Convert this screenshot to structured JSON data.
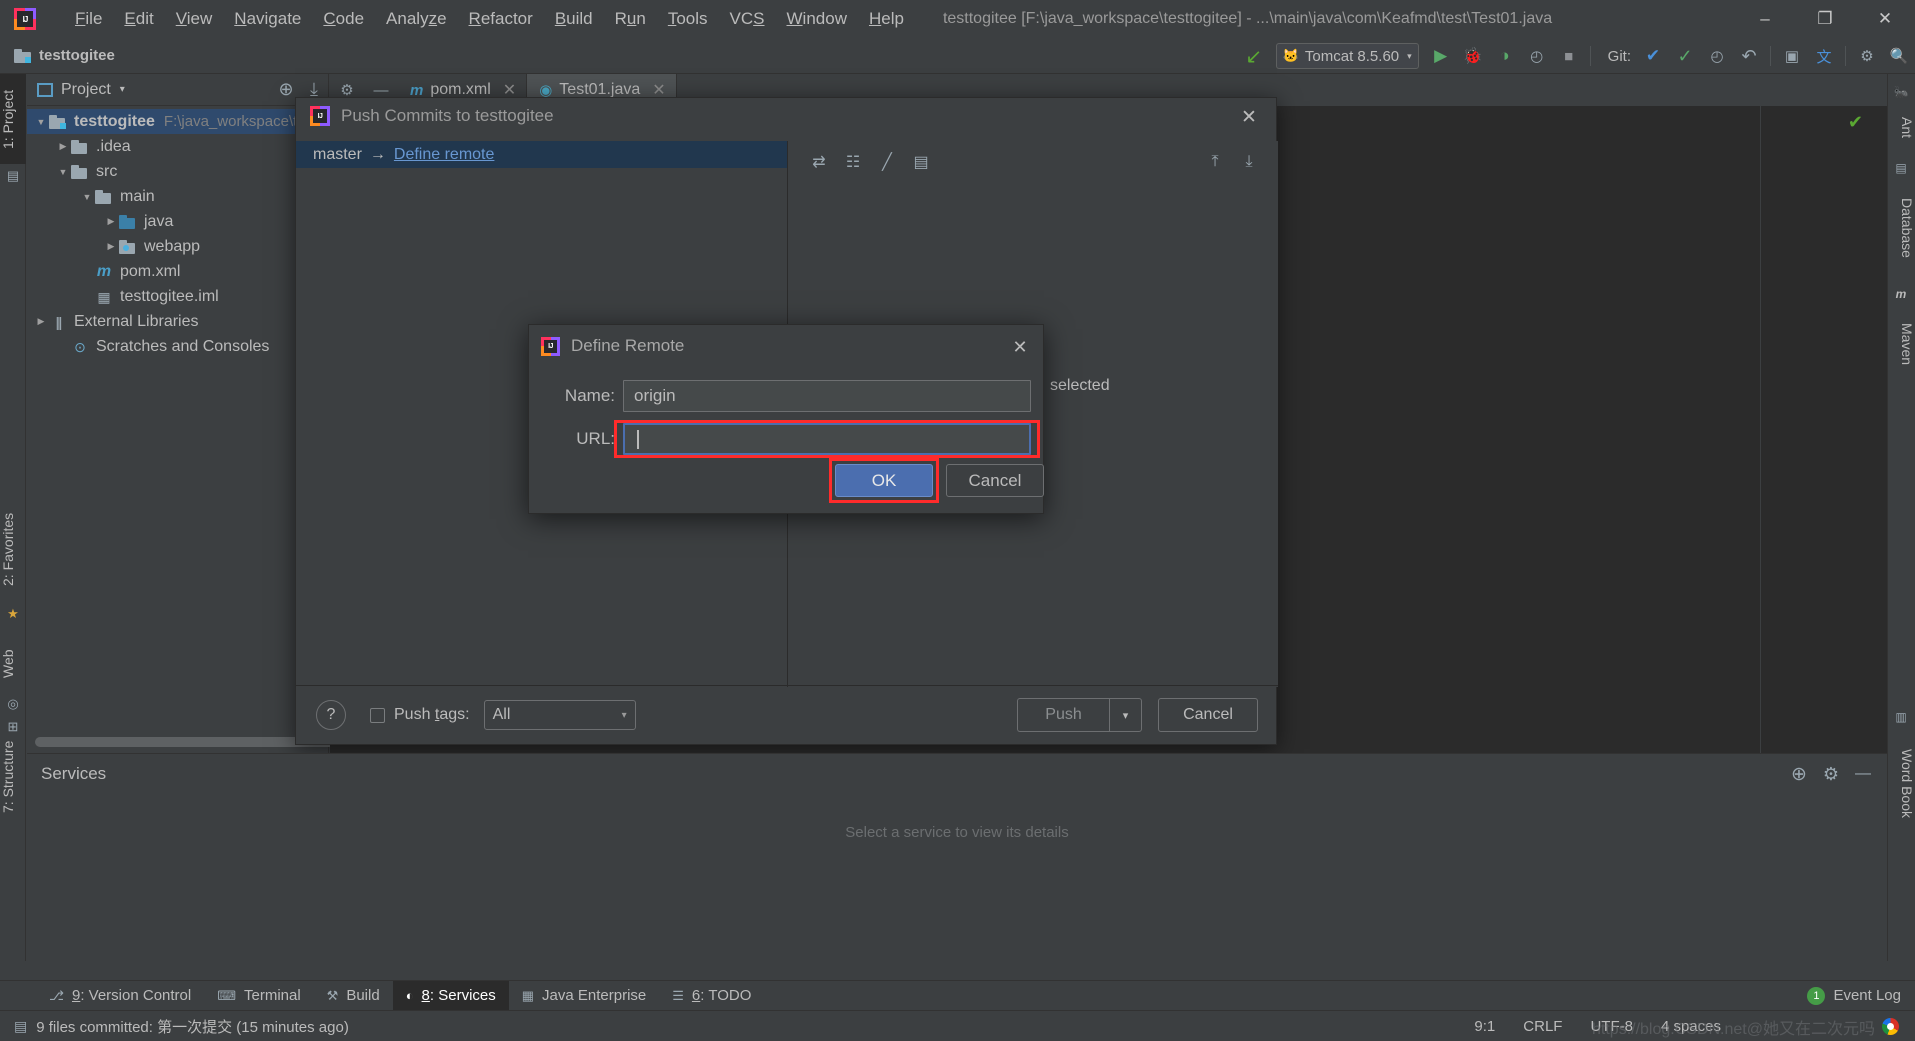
{
  "window": {
    "app_icon": "intellij-logo-icon",
    "title": "testtogitee [F:\\java_workspace\\testtogitee] - ...\\main\\java\\com\\Keafmd\\test\\Test01.java",
    "minimize": "–",
    "maximize": "❐",
    "close": "✕"
  },
  "menubar": {
    "items": [
      {
        "label": "File",
        "mnemonic": "F"
      },
      {
        "label": "Edit",
        "mnemonic": "E"
      },
      {
        "label": "View",
        "mnemonic": "V"
      },
      {
        "label": "Navigate",
        "mnemonic": "N"
      },
      {
        "label": "Code",
        "mnemonic": "C"
      },
      {
        "label": "Analyze",
        "mnemonic": "z"
      },
      {
        "label": "Refactor",
        "mnemonic": "R"
      },
      {
        "label": "Build",
        "mnemonic": "B"
      },
      {
        "label": "Run",
        "mnemonic": "u"
      },
      {
        "label": "Tools",
        "mnemonic": "T"
      },
      {
        "label": "VCS",
        "mnemonic": "S"
      },
      {
        "label": "Window",
        "mnemonic": "W"
      },
      {
        "label": "Help",
        "mnemonic": "H"
      }
    ]
  },
  "navbar": {
    "project_name": "testtogitee",
    "run_config": "Tomcat 8.5.60",
    "git_label": "Git:",
    "caret": "▾",
    "icons": {
      "update": "↙",
      "tomcat": "🐱",
      "run": "▶",
      "debug": "🐞",
      "run_coverage": "◑",
      "profile": "◴",
      "stop": "■",
      "git_update": "✔",
      "git_commit": "✓",
      "git_history": "◴",
      "git_rollback": "↶",
      "search_everywhere": "🔍",
      "settings": "⚙",
      "layout": "▣",
      "translate": "文"
    }
  },
  "left_tool_strip": {
    "items": [
      {
        "label": "1: Project",
        "icon": "project-icon",
        "selected": true
      },
      {
        "label": "2: Favorites",
        "icon": "star-icon",
        "selected": false
      },
      {
        "label": "Web",
        "icon": "globe-icon",
        "selected": false
      },
      {
        "label": "7: Structure",
        "icon": "structure-icon",
        "selected": false
      }
    ]
  },
  "right_tool_strip": {
    "items": [
      {
        "label": "Ant",
        "icon": "ant-icon"
      },
      {
        "label": "Database",
        "icon": "database-icon"
      },
      {
        "label": "Maven",
        "icon": "maven-icon"
      },
      {
        "label": "Word Book",
        "icon": "book-icon"
      }
    ]
  },
  "project_panel": {
    "title": "Project",
    "caret": "▾",
    "actions": [
      {
        "name": "locate-icon",
        "glyph": "⊕"
      },
      {
        "name": "collapse-all-icon",
        "glyph": "⤓"
      },
      {
        "name": "settings-gear-icon",
        "glyph": "⚙"
      },
      {
        "name": "hide-icon",
        "glyph": "—"
      }
    ],
    "tree": [
      {
        "label": "testtogitee",
        "path": "F:\\java_workspace\\t",
        "icon": "project-folder-icon",
        "arrow": "▼",
        "indent": 0,
        "selected": true,
        "bold": true
      },
      {
        "label": ".idea",
        "path": "",
        "icon": "folder-icon",
        "arrow": "▶",
        "indent": 1,
        "selected": false,
        "bold": false
      },
      {
        "label": "src",
        "path": "",
        "icon": "folder-icon",
        "arrow": "▼",
        "indent": 1,
        "selected": false,
        "bold": false
      },
      {
        "label": "main",
        "path": "",
        "icon": "folder-icon",
        "arrow": "▼",
        "indent": 2,
        "selected": false,
        "bold": false
      },
      {
        "label": "java",
        "path": "",
        "icon": "source-folder-icon",
        "arrow": "▶",
        "indent": 3,
        "selected": false,
        "bold": false
      },
      {
        "label": "webapp",
        "path": "",
        "icon": "web-folder-icon",
        "arrow": "▶",
        "indent": 3,
        "selected": false,
        "bold": false
      },
      {
        "label": "pom.xml",
        "path": "",
        "icon": "maven-file-icon",
        "arrow": "",
        "indent": 2,
        "selected": false,
        "bold": false
      },
      {
        "label": "testtogitee.iml",
        "path": "",
        "icon": "iml-file-icon",
        "arrow": "",
        "indent": 2,
        "selected": false,
        "bold": false
      },
      {
        "label": "External Libraries",
        "path": "",
        "icon": "libraries-icon",
        "arrow": "▶",
        "indent": 0,
        "selected": false,
        "bold": false
      },
      {
        "label": "Scratches and Consoles",
        "path": "",
        "icon": "scratches-icon",
        "arrow": "",
        "indent": 1,
        "selected": false,
        "bold": false
      }
    ]
  },
  "editor_tabs": [
    {
      "label": "pom.xml",
      "icon": "maven-file-icon",
      "close": "✕",
      "active": false
    },
    {
      "label": "Test01.java",
      "icon": "java-class-icon",
      "close": "✕",
      "active": true
    }
  ],
  "push_dialog": {
    "title": "Push Commits to testtogitee",
    "close": "✕",
    "branch": {
      "source": "master",
      "arrow": "→",
      "link": "Define remote"
    },
    "toolbar_icons": [
      {
        "name": "show-diff-icon",
        "glyph": "⇄"
      },
      {
        "name": "group-by-icon",
        "glyph": "☷"
      },
      {
        "name": "highlight-icon",
        "glyph": "╱"
      },
      {
        "name": "preview-icon",
        "glyph": "▤"
      },
      {
        "name": "expand-all-icon",
        "glyph": "⤒"
      },
      {
        "name": "collapse-all-icon",
        "glyph": "⤓"
      }
    ],
    "selected_hint": "selected",
    "help_glyph": "?",
    "push_tags_label": "Push tags:",
    "push_tags_mnemonic": "t",
    "push_tags_checked": false,
    "tags_value": "All",
    "tags_caret": "▾",
    "push_button": "Push",
    "push_caret": "▾",
    "cancel_button": "Cancel"
  },
  "define_remote_dialog": {
    "title": "Define Remote",
    "close": "✕",
    "name_label": "Name:",
    "name_value": "origin",
    "url_label": "URL:",
    "url_value": "",
    "url_placeholder": "",
    "ok_button": "OK",
    "cancel_button": "Cancel",
    "highlight_color": "#ff2b2b",
    "accent_color": "#4b6eaf"
  },
  "services_panel": {
    "title": "Services",
    "actions": [
      {
        "name": "add-service-icon",
        "glyph": "⊕"
      },
      {
        "name": "settings-gear-icon",
        "glyph": "⚙"
      },
      {
        "name": "hide-icon",
        "glyph": "—"
      }
    ],
    "hint": "Select a service to view its details"
  },
  "tool_window_bar": {
    "items": [
      {
        "label": "9: Version Control",
        "mnemonic": "9",
        "icon": "branch-icon",
        "glyph": "⎇",
        "active": false
      },
      {
        "label": "Terminal",
        "mnemonic": "",
        "icon": "terminal-icon",
        "glyph": "⌨",
        "active": false
      },
      {
        "label": "Build",
        "mnemonic": "",
        "icon": "hammer-icon",
        "glyph": "⚒",
        "active": false
      },
      {
        "label": "8: Services",
        "mnemonic": "8",
        "icon": "services-icon",
        "glyph": "◐",
        "active": true
      },
      {
        "label": "Java Enterprise",
        "mnemonic": "",
        "icon": "java-ee-icon",
        "glyph": "▦",
        "active": false
      },
      {
        "label": "6: TODO",
        "mnemonic": "6",
        "icon": "todo-icon",
        "glyph": "☰",
        "active": false
      }
    ],
    "event_log": {
      "label": "Event Log",
      "count": "1"
    }
  },
  "status_bar": {
    "icon": "commit-icon",
    "message": "9 files committed: 第一次提交 (15 minutes ago)",
    "caret_position": "9:1",
    "line_separator": "CRLF",
    "encoding": "UTF-8",
    "indent": "4 spaces",
    "watermark": "https://blog.CSDN.net@她又在二次元吗",
    "browser_icon": "chrome-icon"
  }
}
